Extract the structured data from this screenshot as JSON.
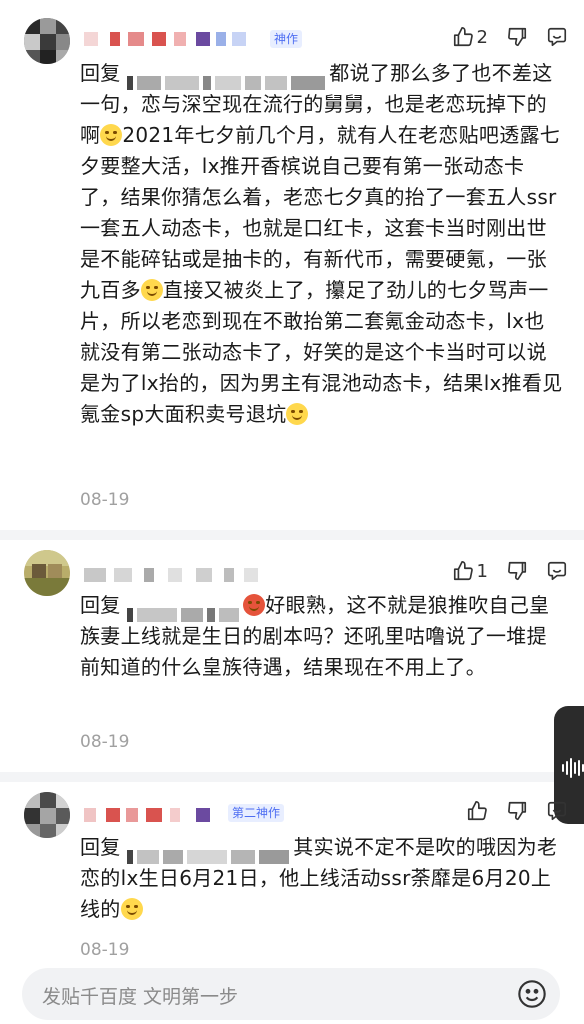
{
  "comments": [
    {
      "badge": "神作",
      "likes": "2",
      "reply_prefix": "回复",
      "text": "都说了那么多了也不差这一句，恋与深空现在流行的舅舅，也是老恋玩掉下的啊",
      "text2": "2021年七夕前几个月，就有人在老恋贴吧透露七夕要整大活，lx推开香槟说自己要有第一张动态卡了，结果你猜怎么着，老恋七夕真的抬了一套五人ssr一套五人动态卡，也就是口红卡，这套卡当时刚出世是不能碎钻或是抽卡的，有新代币，需要硬氪，一张九百多",
      "text3": "直接又被炎上了，攥足了劲儿的七夕骂声一片，所以老恋到现在不敢抬第二套氪金动态卡，lx也就没有第二张动态卡了，好笑的是这个卡当时可以说是为了lx抬的，因为男主有混池动态卡，结果lx推看见氪金sp大面积卖号退坑",
      "date": "08-19"
    },
    {
      "likes": "1",
      "reply_prefix": "回复",
      "text": "好眼熟，这不就是狼推吹自己皇族妻上线就是生日的剧本吗？还吼里咕噜说了一堆提前知道的什么皇族待遇，结果现在不用上了。",
      "date": "08-19"
    },
    {
      "badge": "第二神作",
      "reply_prefix": "回复",
      "text": "其实说不定不是吹的哦因为老恋的lx生日6月21日，他上线活动ssr荼靡是6月20上线的",
      "date": "08-19"
    }
  ],
  "input": {
    "placeholder": "发贴千百度 文明第一步"
  },
  "icons": [
    "thumb-up-icon",
    "thumbs-down-icon",
    "reply-icon",
    "emoji-icon",
    "sound-wave-icon"
  ]
}
